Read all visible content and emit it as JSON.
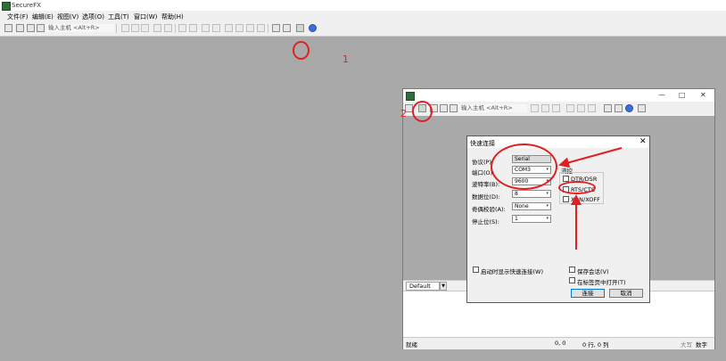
{
  "app": {
    "title": "SecureFX"
  },
  "menu": [
    "文件(F)",
    "编辑(E)",
    "视图(V)",
    "选项(O)",
    "工具(T)",
    "窗口(W)",
    "帮助(H)"
  ],
  "toolbar": {
    "host_placeholder": "输入主机 <Alt+R>"
  },
  "annotations": {
    "step1": "1",
    "step2": "2"
  },
  "child_window": {
    "host_placeholder": "输入主机 <Alt+R>",
    "tab_label": "Default",
    "status": {
      "left": "就绪",
      "coords": "0, 0",
      "rowcol": "0 行, 0 列",
      "caps": "大写",
      "num": "数字"
    }
  },
  "dialog": {
    "title": "快速连接",
    "protocol_label": "协议(P):",
    "protocol_value": "Serial",
    "port_label": "端口(O):",
    "port_value": "COM3",
    "baud_label": "波特率(B):",
    "baud_value": "9600",
    "databits_label": "数据位(D):",
    "databits_value": "8",
    "parity_label": "奇偶校验(A):",
    "parity_value": "None",
    "stopbits_label": "停止位(S):",
    "stopbits_value": "1",
    "flow_label": "流控",
    "flow_dtr": "DTR/DSR",
    "flow_rts": "RTS/CTS",
    "flow_xon": "XON/XOFF",
    "show_on_startup": "启动时显示快速连接(W)",
    "save_session": "保存会话(V)",
    "open_in_tab": "在标签页中打开(T)",
    "connect": "连接",
    "cancel": "取消"
  },
  "colors": {
    "annotation": "#e02020",
    "workspace": "#a9a9a9"
  }
}
